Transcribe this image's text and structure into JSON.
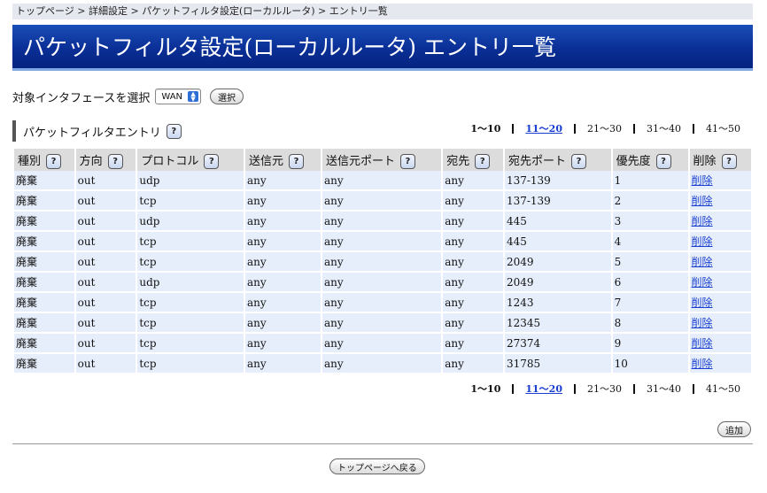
{
  "breadcrumb": "トップページ > 詳細設定 > パケットフィルタ設定(ローカルルータ) > エントリ一覧",
  "page_title": "パケットフィルタ設定(ローカルルータ) エントリ一覧",
  "interface": {
    "label": "対象インタフェースを選択",
    "selected": "WAN",
    "select_button": "選択"
  },
  "section": {
    "title": "パケットフィルタエントリ",
    "help": "?"
  },
  "pager": {
    "pages": [
      {
        "label": "1〜10",
        "state": "current"
      },
      {
        "label": "11〜20",
        "state": "link"
      },
      {
        "label": "21〜30",
        "state": "plain"
      },
      {
        "label": "31〜40",
        "state": "plain"
      },
      {
        "label": "41〜50",
        "state": "plain"
      }
    ]
  },
  "table": {
    "columns": [
      "種別",
      "方向",
      "プロトコル",
      "送信元",
      "送信元ポート",
      "宛先",
      "宛先ポート",
      "優先度",
      "削除"
    ],
    "help": "?",
    "rows": [
      [
        "廃棄",
        "out",
        "udp",
        "any",
        "any",
        "any",
        "137-139",
        "1",
        "削除"
      ],
      [
        "廃棄",
        "out",
        "tcp",
        "any",
        "any",
        "any",
        "137-139",
        "2",
        "削除"
      ],
      [
        "廃棄",
        "out",
        "udp",
        "any",
        "any",
        "any",
        "445",
        "3",
        "削除"
      ],
      [
        "廃棄",
        "out",
        "tcp",
        "any",
        "any",
        "any",
        "445",
        "4",
        "削除"
      ],
      [
        "廃棄",
        "out",
        "tcp",
        "any",
        "any",
        "any",
        "2049",
        "5",
        "削除"
      ],
      [
        "廃棄",
        "out",
        "udp",
        "any",
        "any",
        "any",
        "2049",
        "6",
        "削除"
      ],
      [
        "廃棄",
        "out",
        "tcp",
        "any",
        "any",
        "any",
        "1243",
        "7",
        "削除"
      ],
      [
        "廃棄",
        "out",
        "tcp",
        "any",
        "any",
        "any",
        "12345",
        "8",
        "削除"
      ],
      [
        "廃棄",
        "out",
        "tcp",
        "any",
        "any",
        "any",
        "27374",
        "9",
        "削除"
      ],
      [
        "廃棄",
        "out",
        "tcp",
        "any",
        "any",
        "any",
        "31785",
        "10",
        "削除"
      ]
    ]
  },
  "add_button": "追加",
  "back_button": "トップページへ戻る",
  "colors": {
    "title_bar": "#0a2f96",
    "row_bg": "#e6eefb",
    "header_bg": "#dcdcdc",
    "link": "#1a3fd0"
  }
}
